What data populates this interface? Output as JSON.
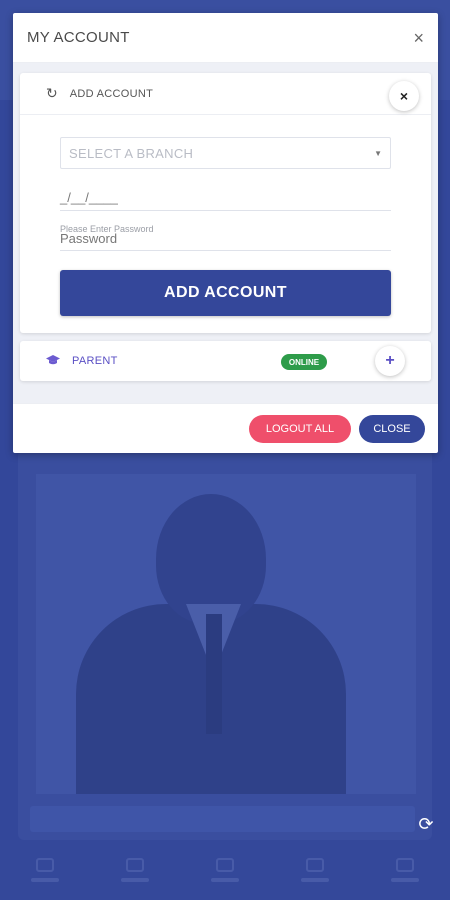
{
  "modal": {
    "title": "MY ACCOUNT",
    "close_icon": "×"
  },
  "add_account_panel": {
    "heading": "ADD ACCOUNT",
    "refresh_icon": "↻",
    "close_icon": "×",
    "branch_select": {
      "placeholder": "SELECT A BRANCH",
      "caret": "▼"
    },
    "date_field": {
      "value": "_/__/____"
    },
    "password_field": {
      "hint": "Please Enter Password",
      "placeholder": "Password"
    },
    "submit_label": "ADD ACCOUNT"
  },
  "parent_panel": {
    "icon": "graduation-cap-icon",
    "label": "PARENT",
    "status": "ONLINE",
    "plus_icon": "+"
  },
  "footer": {
    "logout_all_label": "LOGOUT ALL",
    "close_label": "CLOSE"
  },
  "background": {
    "fab_icon": "⟳"
  },
  "colors": {
    "primary": "#34479a",
    "danger": "#ef4f6b",
    "success": "#2e9c4a",
    "accent": "#5a4fc4"
  }
}
